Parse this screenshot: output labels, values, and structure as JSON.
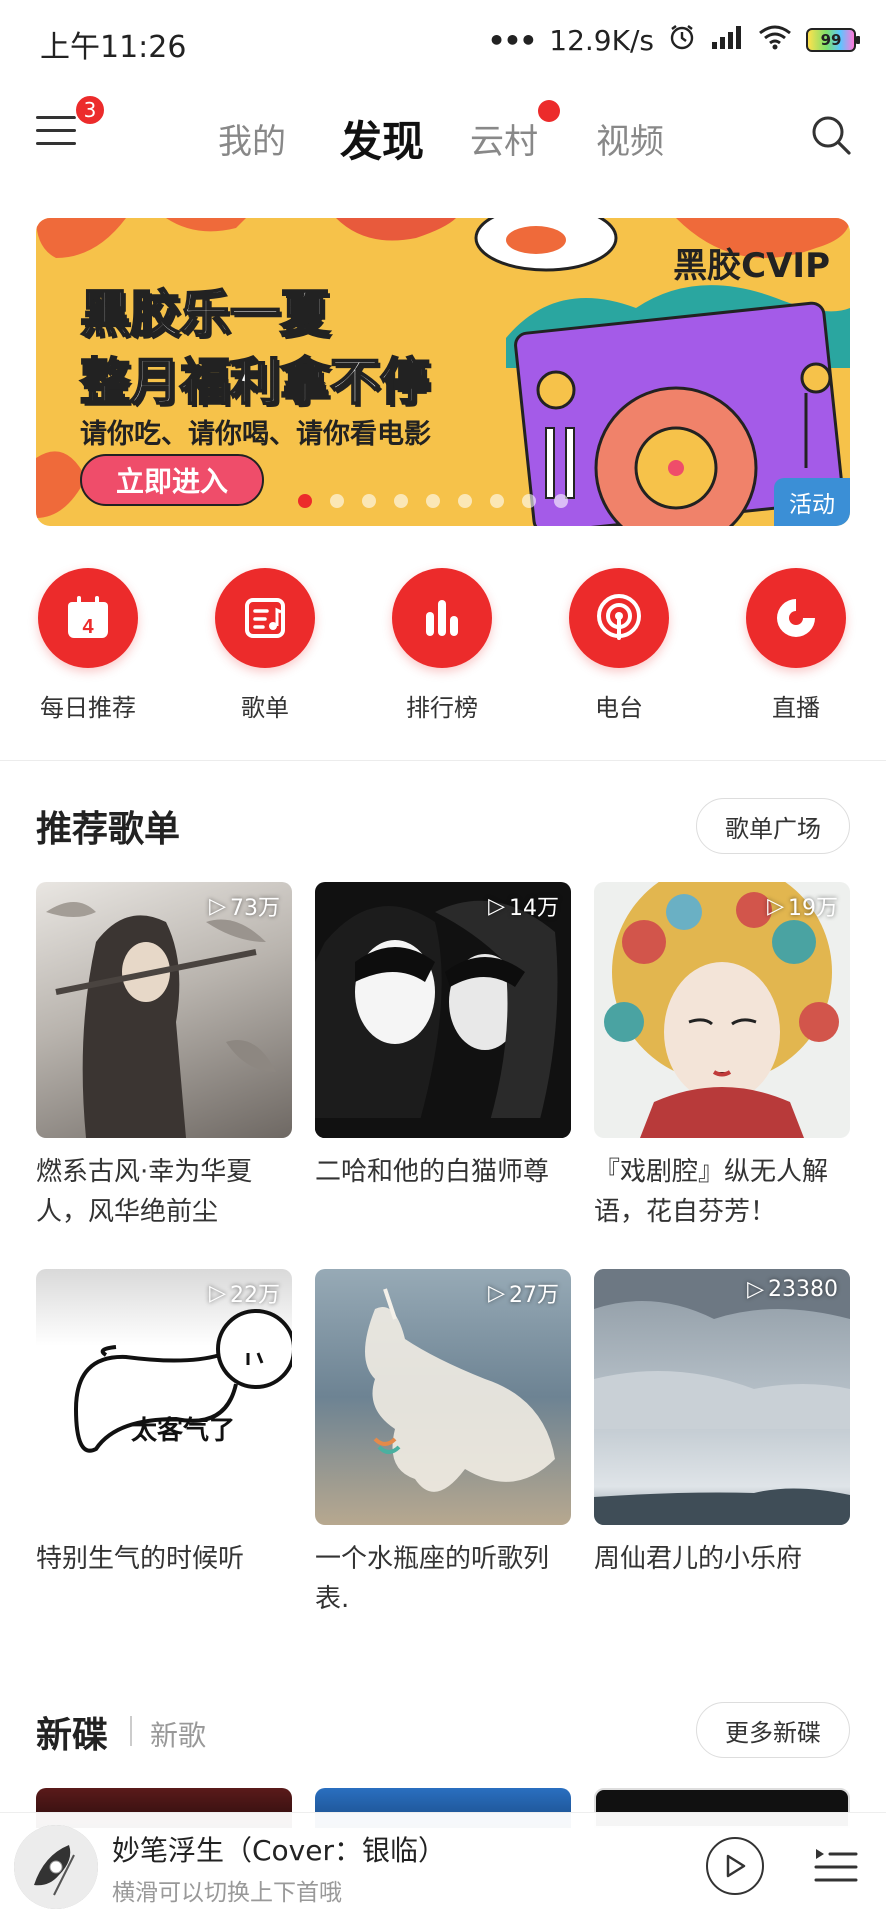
{
  "status": {
    "time": "上午11:26",
    "dots": "•••",
    "speed": "12.9K/s",
    "battery": "99"
  },
  "header": {
    "menu_badge": "3",
    "tabs": [
      {
        "label": "我的"
      },
      {
        "label": "发现"
      },
      {
        "label": "云村"
      },
      {
        "label": "视频"
      }
    ]
  },
  "banner": {
    "line1": "黑胶乐一夏",
    "line2": "整月福利拿不停",
    "line3": "请你吃、请你喝、请你看电影",
    "cta": "立即进入",
    "brand": "黑胶CVIP",
    "tag": "活动",
    "active_page": 1,
    "page_count": 9
  },
  "quick": [
    {
      "label": "每日推荐",
      "icon": "calendar-icon",
      "day": "4"
    },
    {
      "label": "歌单",
      "icon": "playlist-icon"
    },
    {
      "label": "排行榜",
      "icon": "chart-bars-icon"
    },
    {
      "label": "电台",
      "icon": "podcast-icon"
    },
    {
      "label": "直播",
      "icon": "live-icon"
    }
  ],
  "recommend": {
    "title": "推荐歌单",
    "more": "歌单广场",
    "items": [
      {
        "title": "燃系古风·幸为华夏人，风华绝前尘",
        "count": "73万"
      },
      {
        "title": "二哈和他的白猫师尊",
        "count": "14万"
      },
      {
        "title": "『戏剧腔』纵无人解语，花自芬芳！",
        "count": "19万"
      },
      {
        "title": "特别生气的时候听",
        "count": "22万"
      },
      {
        "title": "一个水瓶座的听歌列表.",
        "count": "27万"
      },
      {
        "title": "周仙君儿的小乐府",
        "count": "23380"
      }
    ],
    "sticker_text": "太客气了"
  },
  "newdisc": {
    "title": "新碟",
    "sub": "新歌",
    "more": "更多新碟"
  },
  "player": {
    "song": "妙笔浮生（Cover：银临）",
    "hint": "横滑可以切换上下首哦"
  }
}
